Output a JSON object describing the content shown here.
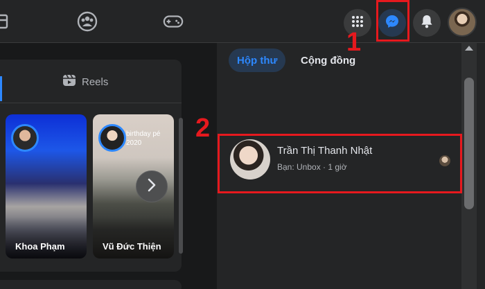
{
  "topbar": {
    "nav_icons": [
      "marketplace-icon",
      "groups-icon",
      "gaming-icon"
    ],
    "right_buttons": [
      "menu-grid-icon",
      "messenger-icon",
      "notifications-icon"
    ],
    "accent_color": "#2d88ff"
  },
  "feed": {
    "reels_label": "Reels",
    "stories": [
      {
        "name": "Khoa Phạm",
        "overlay_text": ""
      },
      {
        "name": "Vũ Đức Thiện",
        "overlay_text": "birthday pé 2020"
      }
    ]
  },
  "messenger_panel": {
    "tabs": [
      {
        "label": "Hộp thư",
        "active": true
      },
      {
        "label": "Cộng đồng",
        "active": false
      }
    ],
    "chats": [
      {
        "name": "Trần Thị Thanh Nhật",
        "meta": "Bạn: Unbox · 1 giờ"
      }
    ]
  },
  "annotations": {
    "step1": "1",
    "step2": "2",
    "color": "#e6191e"
  }
}
